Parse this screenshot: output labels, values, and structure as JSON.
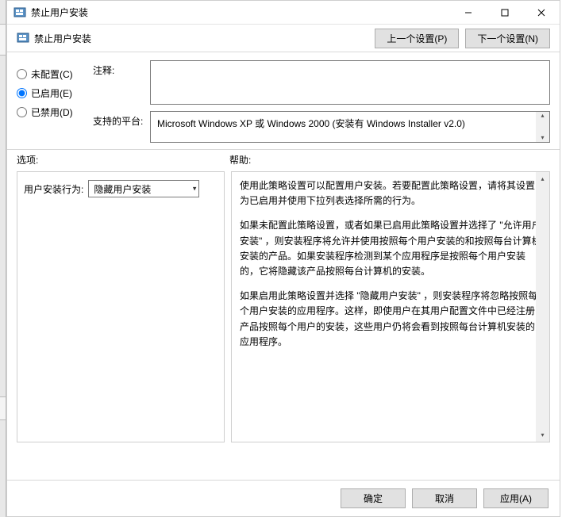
{
  "window": {
    "title": "禁止用户安装"
  },
  "header": {
    "title": "禁止用户安装"
  },
  "nav": {
    "prev": "上一个设置(P)",
    "next": "下一个设置(N)"
  },
  "radios": {
    "not_configured": "未配置(C)",
    "enabled": "已启用(E)",
    "disabled": "已禁用(D)",
    "selected": "enabled"
  },
  "labels": {
    "comment": "注释:",
    "platform": "支持的平台:",
    "options": "选项:",
    "help": "帮助:",
    "user_install_behavior": "用户安装行为:"
  },
  "comment": "",
  "platform": "Microsoft Windows XP 或 Windows 2000 (安装有 Windows Installer v2.0)",
  "dropdown": {
    "selected": "隐藏用户安装"
  },
  "help": {
    "p1": "使用此策略设置可以配置用户安装。若要配置此策略设置，请将其设置为已启用并使用下拉列表选择所需的行为。",
    "p2": "如果未配置此策略设置，或者如果已启用此策略设置并选择了 \"允许用户安装\" ，则安装程序将允许并使用按照每个用户安装的和按照每台计算机安装的产品。如果安装程序检测到某个应用程序是按照每个用户安装的，它将隐藏该产品按照每台计算机的安装。",
    "p3": "如果启用此策略设置并选择 \"隐藏用户安装\" ，则安装程序将忽略按照每个用户安装的应用程序。这样，即使用户在其用户配置文件中已经注册产品按照每个用户的安装，这些用户仍将会看到按照每台计算机安装的应用程序。"
  },
  "footer": {
    "ok": "确定",
    "cancel": "取消",
    "apply": "应用(A)"
  }
}
